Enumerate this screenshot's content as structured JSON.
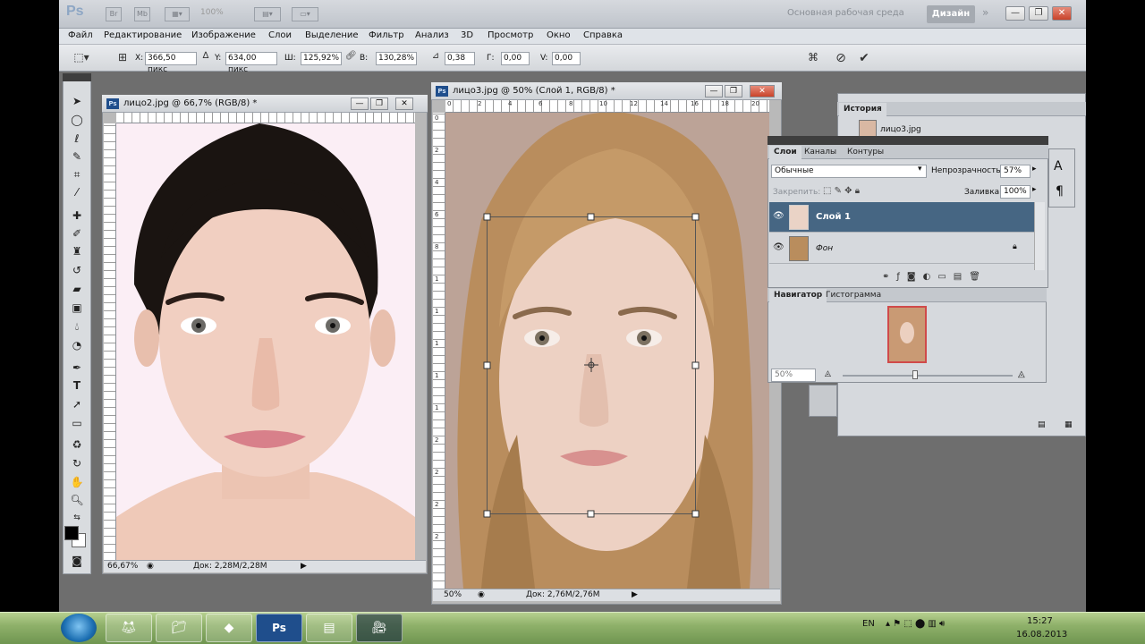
{
  "app": {
    "logo": "Ps",
    "zoom_display": "100%",
    "workspace_label": "Основная рабочая среда",
    "design_button": "Дизайн",
    "window_controls": {
      "minimize": "—",
      "restore": "❐",
      "close": "✕"
    }
  },
  "menu": [
    "Файл",
    "Редактирование",
    "Изображение",
    "Слои",
    "Выделение",
    "Фильтр",
    "Анализ",
    "3D",
    "Просмотр",
    "Окно",
    "Справка"
  ],
  "options": {
    "x_label": "X:",
    "x_value": "366,50 пикс",
    "y_label": "Y:",
    "y_value": "634,00 пикс",
    "w_label": "Ш:",
    "w_value": "125,92%",
    "h_label": "В:",
    "h_value": "130,28%",
    "angle_value": "0,38",
    "hskew_label": "Г:",
    "hskew_value": "0,00",
    "vskew_label": "V:",
    "vskew_value": "0,00",
    "cancel_icon": "⊘",
    "commit_icon": "✔"
  },
  "docs": {
    "left": {
      "title": "лицо2.jpg @ 66,7% (RGB/8) *",
      "zoom": "66,67%",
      "doc_info": "Док: 2,28M/2,28M",
      "skin": "#f1cfc1",
      "hair": "#1a1411"
    },
    "right": {
      "title": "лицо3.jpg @ 50% (Слой 1, RGB/8) *",
      "zoom": "50%",
      "doc_info": "Док: 2,76M/2,76M",
      "ruler_ticks": [
        "0",
        "2",
        "4",
        "6",
        "8",
        "10",
        "12",
        "14",
        "16",
        "18",
        "20"
      ],
      "vruler_ticks": [
        "0",
        "2",
        "4",
        "6",
        "8",
        "1",
        "1",
        "1",
        "1",
        "1",
        "2",
        "2",
        "2",
        "2"
      ],
      "skin": "#edd1c3",
      "hair": "#b98d5d"
    }
  },
  "history": {
    "tab": "История",
    "item": "лицо3.jpg"
  },
  "layers": {
    "tabs": [
      "Слои",
      "Каналы",
      "Контуры"
    ],
    "blend_mode": "Обычные",
    "opacity_label": "Непрозрачность:",
    "opacity_value": "57%",
    "lock_label": "Закрепить:",
    "fill_label": "Заливка:",
    "fill_value": "100%",
    "rows": [
      {
        "name": "Слой 1",
        "selected": true
      },
      {
        "name": "Фон",
        "selected": false
      }
    ]
  },
  "navigator": {
    "tabs": [
      "Навигатор",
      "Гистограмма"
    ],
    "zoom": "50%"
  },
  "taskbar": {
    "language": "EN",
    "time": "15:27",
    "date": "16.08.2013",
    "ps_label": "Ps"
  }
}
